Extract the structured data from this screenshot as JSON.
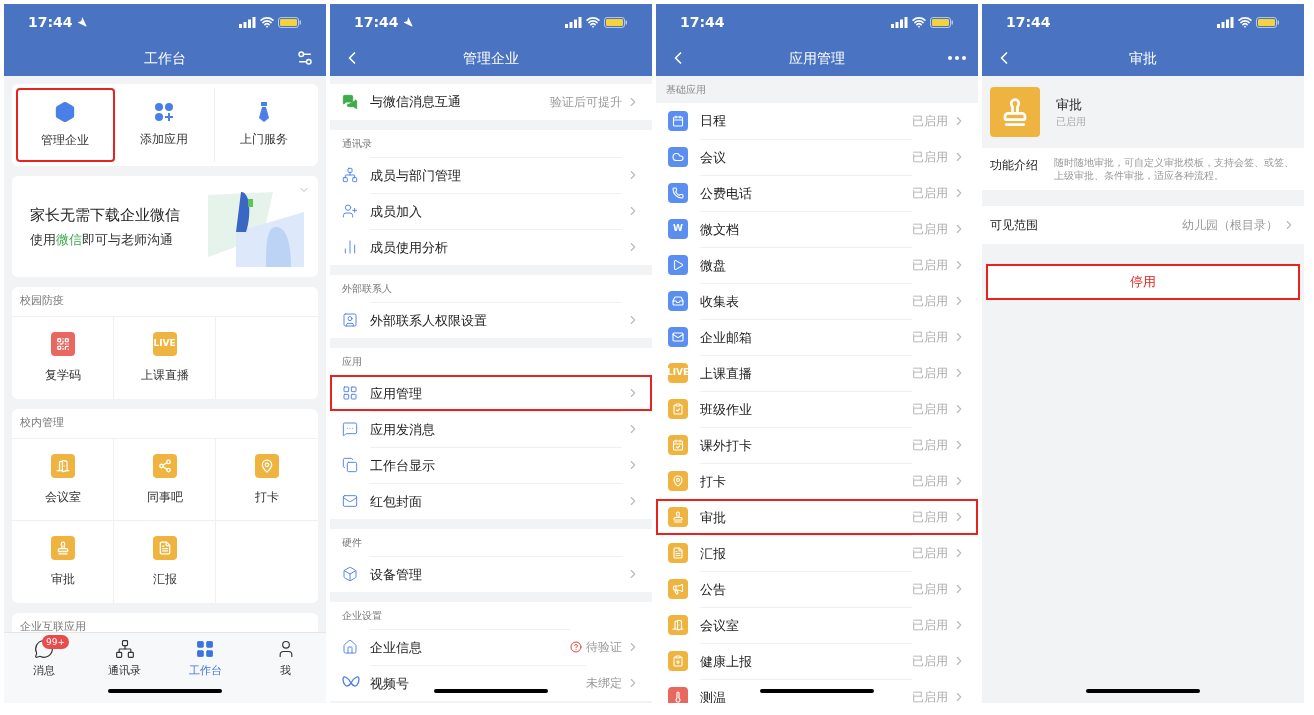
{
  "screens": [
    {
      "kind": "workbench",
      "status": {
        "time": "17:44",
        "location": true
      },
      "nav": {
        "title": "工作台",
        "settings": true
      },
      "quick_actions": [
        {
          "label": "管理企业",
          "highlighted": true
        },
        {
          "label": "添加应用",
          "highlighted": false
        },
        {
          "label": "上门服务",
          "highlighted": false
        }
      ],
      "banner": {
        "headline": "家长无需下载企业微信",
        "sub_before": "使用",
        "sub_highlight": "微信",
        "sub_after": "即可与老师沟通"
      },
      "sections": [
        {
          "title": "校园防疫",
          "apps": [
            {
              "label": "复学码",
              "color": "#e8675f"
            },
            {
              "label": "上课直播",
              "color": "#efb440",
              "badge_text": "LIVE"
            }
          ]
        },
        {
          "title": "校内管理",
          "apps": [
            {
              "label": "会议室",
              "color": "#efb440"
            },
            {
              "label": "同事吧",
              "color": "#efb440"
            },
            {
              "label": "打卡",
              "color": "#efb440"
            },
            {
              "label": "审批",
              "color": "#efb440"
            },
            {
              "label": "汇报",
              "color": "#efb440"
            }
          ]
        },
        {
          "title": "企业互联应用"
        }
      ],
      "tabbar": [
        {
          "label": "消息",
          "badge": "99+",
          "selected": false
        },
        {
          "label": "通讯录",
          "selected": false
        },
        {
          "label": "工作台",
          "selected": true
        },
        {
          "label": "我",
          "selected": false
        }
      ]
    },
    {
      "kind": "settings",
      "status": {
        "time": "17:44",
        "location": true
      },
      "nav": {
        "title": "管理企业",
        "back": true
      },
      "groups": [
        {
          "rows": [
            {
              "label": "与微信消息互通",
              "value": "验证后可提升",
              "alert": false,
              "highlighted": false
            }
          ]
        },
        {
          "title": "通讯录",
          "rows": [
            {
              "label": "成员与部门管理",
              "alert": false,
              "highlighted": false
            },
            {
              "label": "成员加入",
              "alert": false,
              "highlighted": false
            },
            {
              "label": "成员使用分析",
              "alert": false,
              "highlighted": false
            }
          ]
        },
        {
          "title": "外部联系人",
          "rows": [
            {
              "label": "外部联系人权限设置",
              "alert": false,
              "highlighted": false
            }
          ]
        },
        {
          "title": "应用",
          "rows": [
            {
              "label": "应用管理",
              "alert": false,
              "highlighted": true
            },
            {
              "label": "应用发消息",
              "alert": false,
              "highlighted": false
            },
            {
              "label": "工作台显示",
              "alert": false,
              "highlighted": false
            },
            {
              "label": "红包封面",
              "alert": false,
              "highlighted": false
            }
          ]
        },
        {
          "title": "硬件",
          "rows": [
            {
              "label": "设备管理",
              "alert": false,
              "highlighted": false
            }
          ]
        },
        {
          "title": "企业设置",
          "rows": [
            {
              "label": "企业信息",
              "value": "待验证",
              "alert": true,
              "highlighted": false
            },
            {
              "label": "视频号",
              "value": "未绑定",
              "alert": false,
              "highlighted": false
            }
          ]
        }
      ]
    },
    {
      "kind": "app_list",
      "status": {
        "time": "17:44"
      },
      "nav": {
        "title": "应用管理",
        "back": true,
        "more": true
      },
      "section_title": "基础应用",
      "apps": [
        {
          "label": "日程",
          "status": "已启用",
          "color": "#5a8ef0",
          "highlighted": false
        },
        {
          "label": "会议",
          "status": "已启用",
          "color": "#5a8ef0",
          "highlighted": false
        },
        {
          "label": "公费电话",
          "status": "已启用",
          "color": "#5a8ef0",
          "highlighted": false
        },
        {
          "label": "微文档",
          "status": "已启用",
          "color": "#5a8ef0",
          "badge_text": "W",
          "highlighted": false
        },
        {
          "label": "微盘",
          "status": "已启用",
          "color": "#5a8ef0",
          "highlighted": false
        },
        {
          "label": "收集表",
          "status": "已启用",
          "color": "#5a8ef0",
          "highlighted": false
        },
        {
          "label": "企业邮箱",
          "status": "已启用",
          "color": "#5a8ef0",
          "highlighted": false
        },
        {
          "label": "上课直播",
          "status": "已启用",
          "color": "#efb440",
          "badge_text": "LIVE",
          "highlighted": false
        },
        {
          "label": "班级作业",
          "status": "已启用",
          "color": "#efb440",
          "highlighted": false
        },
        {
          "label": "课外打卡",
          "status": "已启用",
          "color": "#efb440",
          "highlighted": false
        },
        {
          "label": "打卡",
          "status": "已启用",
          "color": "#efb440",
          "highlighted": false
        },
        {
          "label": "审批",
          "status": "已启用",
          "color": "#efb440",
          "highlighted": true
        },
        {
          "label": "汇报",
          "status": "已启用",
          "color": "#efb440",
          "highlighted": false
        },
        {
          "label": "公告",
          "status": "已启用",
          "color": "#efb440",
          "highlighted": false
        },
        {
          "label": "会议室",
          "status": "已启用",
          "color": "#efb440",
          "highlighted": false
        },
        {
          "label": "健康上报",
          "status": "已启用",
          "color": "#efb440",
          "highlighted": false
        },
        {
          "label": "测温",
          "status": "已启用",
          "color": "#e8675f",
          "highlighted": false
        }
      ]
    },
    {
      "kind": "app_detail",
      "status": {
        "time": "17:44"
      },
      "nav": {
        "title": "审批",
        "back": true
      },
      "app": {
        "name": "审批",
        "status": "已启用",
        "color": "#efb440"
      },
      "intro": {
        "label": "功能介绍",
        "text": "随时随地审批，可自定义审批模板，支持会签、或签、上级审批、条件审批，适应各种流程。"
      },
      "visibility": {
        "label": "可见范围",
        "value": "幼儿园（根目录）"
      },
      "action": {
        "label": "停用",
        "highlighted": true
      }
    }
  ]
}
